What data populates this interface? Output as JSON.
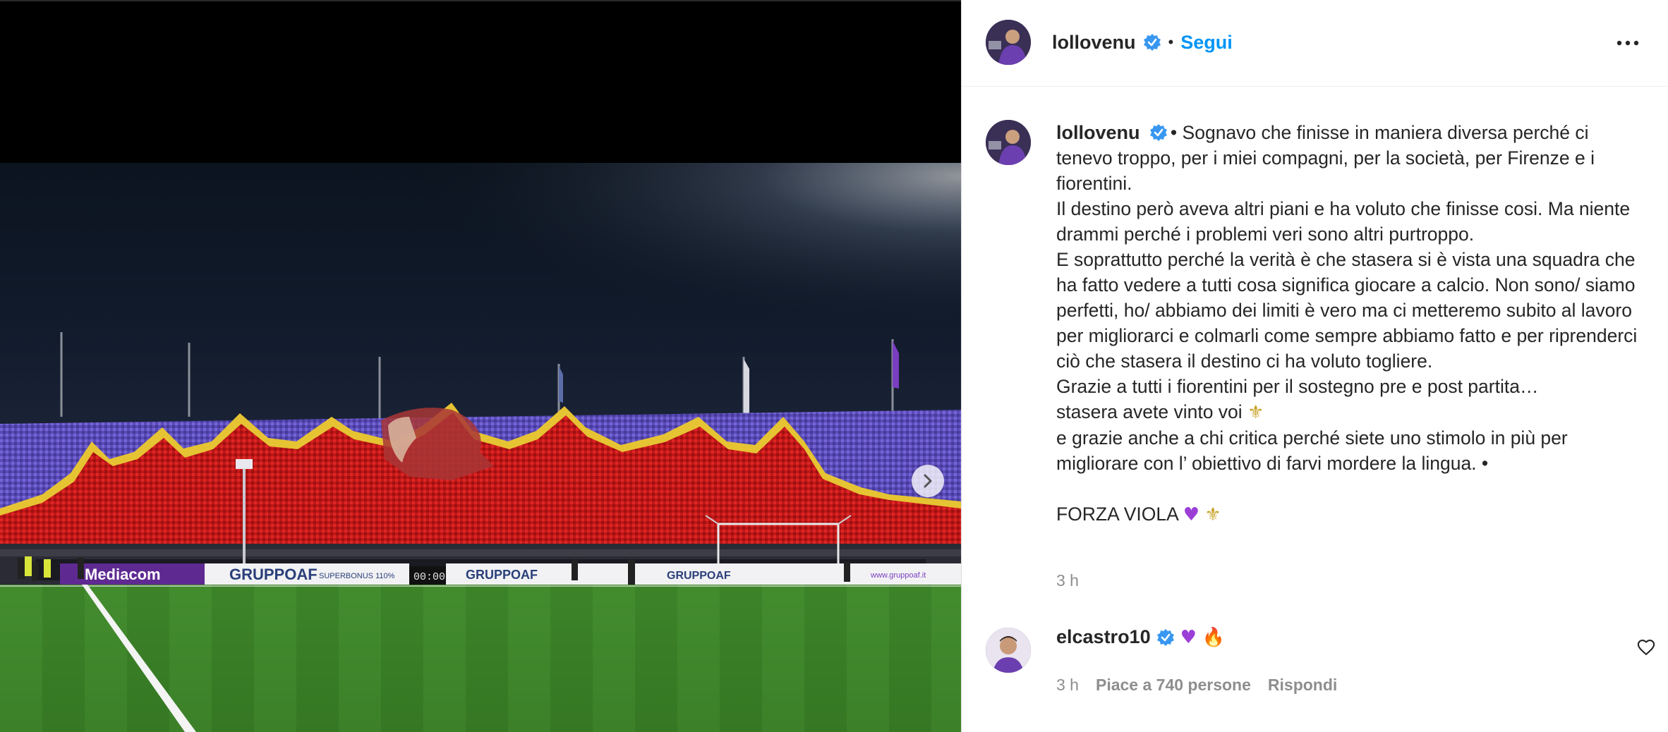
{
  "post": {
    "author": "lollovenu",
    "follow_label": "Segui",
    "separator": "•",
    "caption": {
      "author": "lollovenu",
      "lines": [
        "Sognavo che finisse in maniera diversa perché ci tenevo troppo, per i miei compagni, per la società, per Firenze e i fiorentini.",
        "Il destino però aveva altri piani e ha voluto che finisse cosi. Ma niente drammi perché i problemi veri sono altri purtroppo.",
        "E soprattutto perché la verità è che stasera si è vista una squadra che ha fatto vedere a tutti cosa significa giocare a calcio. Non sono/ siamo perfetti, ho/ abbiamo dei limiti è vero ma ci metteremo subito al lavoro per migliorarci e colmarli come sempre abbiamo fatto e per riprenderci ciò che stasera il destino ci ha voluto togliere.",
        "Grazie a tutti i fiorentini per il sostegno pre e post partita…",
        "stasera avete vinto voi",
        "e grazie anche a chi critica perché siete uno stimolo in più per migliorare con l’ obiettivo di farvi mordere la lingua. •",
        "FORZA VIOLA"
      ],
      "emoji_lily": "⚜",
      "emoji_heart": "♥",
      "time": "3 h"
    },
    "photo": {
      "ad_boards": [
        "Mediacom",
        "GRUPPOAF",
        "SUPERBONUS 110%",
        "00:00",
        "GRUPPOAF",
        "GRUPPOAF",
        "www.gruppoaf.it"
      ]
    }
  },
  "comment": {
    "author": "elcastro10",
    "emoji_heart": "♥",
    "emoji_fire": "🔥",
    "time": "3 h",
    "likes_label": "Piace a 740 persone",
    "reply_label": "Rispondi"
  },
  "colors": {
    "follow": "#0095f6",
    "verified": "#3897f0",
    "muted": "#8e8e8e",
    "text": "#262626"
  }
}
